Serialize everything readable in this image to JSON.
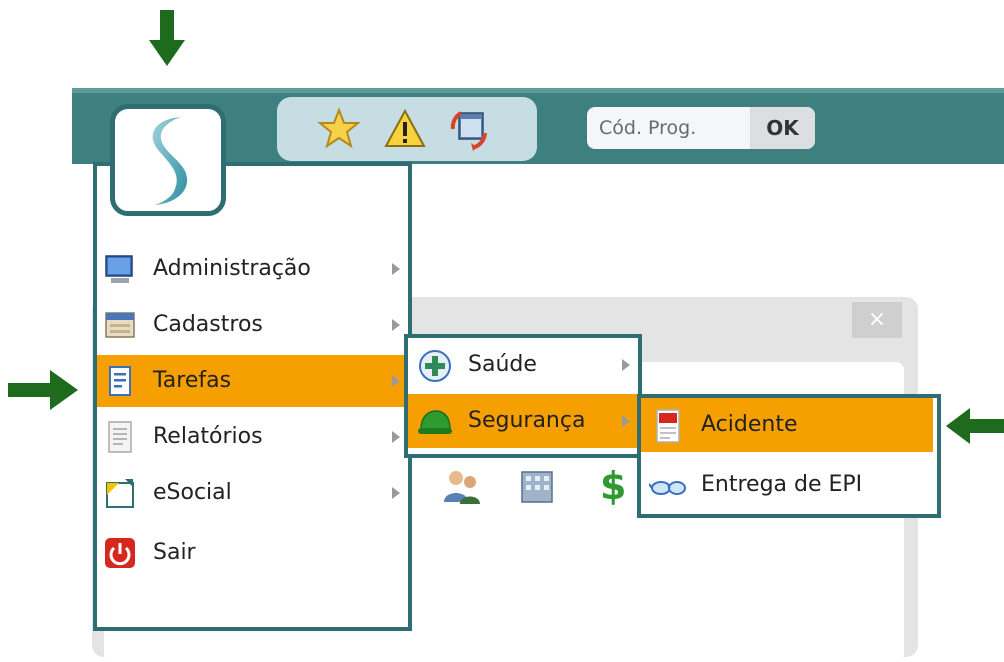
{
  "toolbar": {
    "prog_placeholder": "Cód. Prog.",
    "ok_label": "OK",
    "icons": [
      "star-icon",
      "warning-icon",
      "calendar-sync-icon"
    ]
  },
  "window": {
    "close_label": "×"
  },
  "main_menu": {
    "items": [
      {
        "label": "Administração",
        "icon": "computer-icon",
        "has_submenu": true
      },
      {
        "label": "Cadastros",
        "icon": "card-file-icon",
        "has_submenu": true
      },
      {
        "label": "Tarefas",
        "icon": "task-icon",
        "has_submenu": true,
        "active": true
      },
      {
        "label": "Relatórios",
        "icon": "report-icon",
        "has_submenu": true
      },
      {
        "label": "eSocial",
        "icon": "esocial-icon",
        "has_submenu": true
      },
      {
        "label": "Sair",
        "icon": "power-icon",
        "has_submenu": false
      }
    ]
  },
  "submenu_tarefas": {
    "items": [
      {
        "label": "Saúde",
        "icon": "health-icon",
        "has_submenu": true
      },
      {
        "label": "Segurança",
        "icon": "helmet-icon",
        "has_submenu": true,
        "active": true
      }
    ]
  },
  "submenu_seguranca": {
    "items": [
      {
        "label": "Acidente",
        "icon": "accident-report-icon",
        "active": true
      },
      {
        "label": "Entrega de EPI",
        "icon": "safety-glasses-icon"
      }
    ]
  },
  "colors": {
    "topbar": "#3e7f80",
    "accent_highlight": "#f5a000",
    "menu_border": "#2e6d71",
    "annotation_arrow": "#1e6b1e"
  }
}
